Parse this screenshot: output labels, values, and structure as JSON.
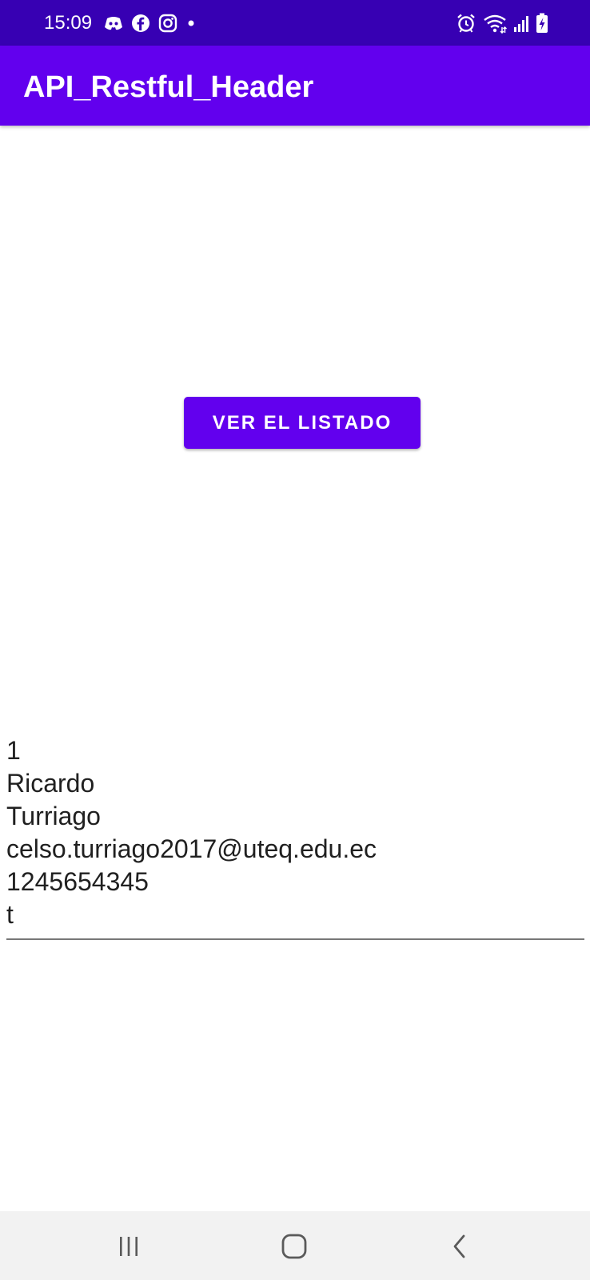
{
  "status_bar": {
    "time": "15:09",
    "bg_color": "#3700b3",
    "left_icons": [
      "discord-icon",
      "facebook-icon",
      "instagram-icon",
      "notification-dot-icon"
    ],
    "right_icons": [
      "alarm-icon",
      "wifi-icon",
      "signal-icon",
      "battery-charging-icon"
    ]
  },
  "app_bar": {
    "title": "API_Restful_Header",
    "bg_color": "#6200ee"
  },
  "main": {
    "button_label": "VER EL LISTADO",
    "result_lines": [
      "1",
      "Ricardo",
      "Turriago",
      "celso.turriago2017@uteq.edu.ec",
      "1245654345",
      "t"
    ]
  },
  "nav_bar": {
    "buttons": [
      "recent-apps-icon",
      "home-icon",
      "back-icon"
    ]
  }
}
